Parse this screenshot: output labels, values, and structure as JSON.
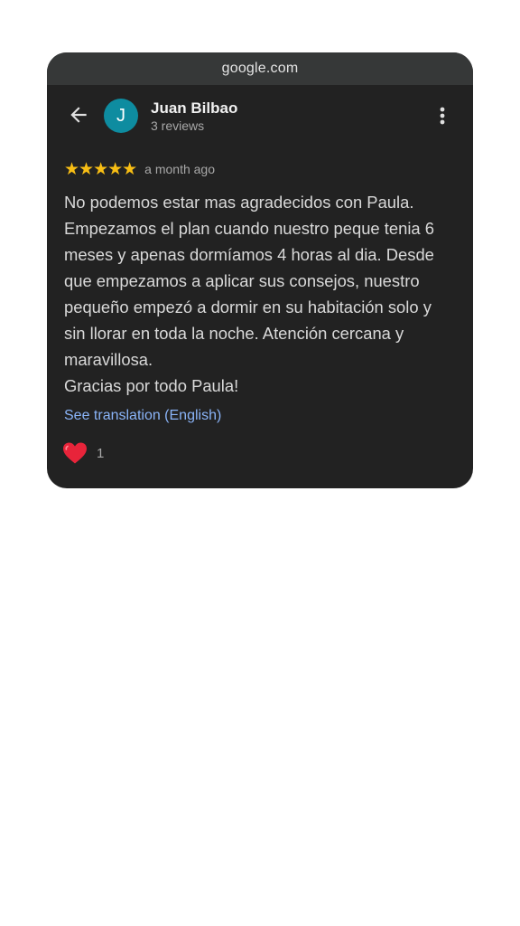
{
  "browser": {
    "url": "google.com"
  },
  "review": {
    "author": "Juan Bilbao",
    "avatar_letter": "J",
    "author_meta": "3 reviews",
    "stars": "★★★★★",
    "rating": 5,
    "time": "a month ago",
    "lines": [
      "No podemos estar mas agradecidos con Paula.",
      "Empezamos el plan cuando nuestro peque tenia 6",
      "meses y apenas dormíamos 4 horas al dia. Desde",
      "que empezamos a aplicar sus consejos, nuestro",
      "pequeño empezó a dormir en su habitación solo y",
      "sin llorar en toda la noche. Atención cercana y",
      "maravillosa.",
      "Gracias por todo Paula!"
    ],
    "translate_label": "See translation (English)",
    "reaction_count": "1"
  },
  "icons": {
    "back": "arrow-left-icon",
    "more": "more-vert-icon",
    "heart": "heart-icon"
  },
  "colors": {
    "card_bg": "#222222",
    "urlbar_bg": "#363838",
    "avatar": "#0e8ca0",
    "stars": "#f8be14",
    "link": "#8ab4f8",
    "heart": "#e8243a"
  }
}
